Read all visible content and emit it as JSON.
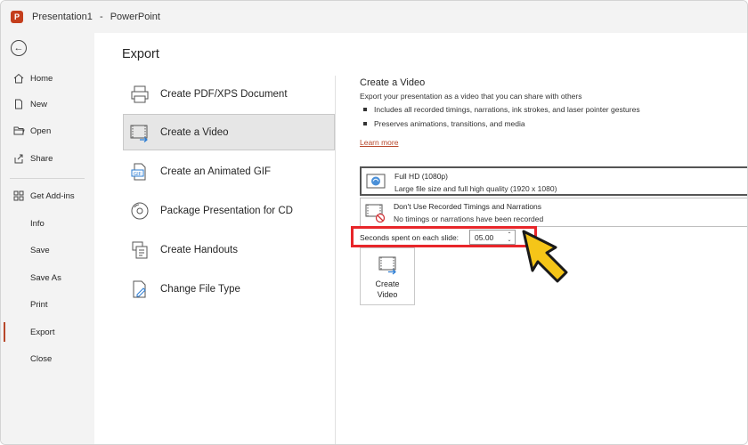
{
  "window": {
    "app_icon_letter": "P",
    "doc_name": "Presentation1",
    "separator": "-",
    "app_name": "PowerPoint"
  },
  "sidebar": {
    "back_icon": "back-arrow-icon",
    "items": [
      {
        "label": "Home",
        "icon": "home-icon"
      },
      {
        "label": "New",
        "icon": "new-file-icon"
      },
      {
        "label": "Open",
        "icon": "folder-open-icon"
      },
      {
        "label": "Share",
        "icon": "share-icon"
      },
      {
        "label": "Get Add-ins",
        "icon": "grid-icon"
      },
      {
        "label": "Info"
      },
      {
        "label": "Save"
      },
      {
        "label": "Save As"
      },
      {
        "label": "Print"
      },
      {
        "label": "Export",
        "active": true
      },
      {
        "label": "Close"
      }
    ]
  },
  "main": {
    "title": "Export",
    "options": [
      {
        "label": "Create PDF/XPS Document",
        "icon": "pdf-printer-icon"
      },
      {
        "label": "Create a Video",
        "icon": "video-icon",
        "selected": true
      },
      {
        "label": "Create an Animated GIF",
        "icon": "gif-icon"
      },
      {
        "label": "Package Presentation for CD",
        "icon": "cd-icon"
      },
      {
        "label": "Create Handouts",
        "icon": "handouts-icon"
      },
      {
        "label": "Change File Type",
        "icon": "file-type-icon"
      }
    ]
  },
  "detail": {
    "title": "Create a Video",
    "description": "Export your presentation as a video that you can share with others",
    "bullets": [
      "Includes all recorded timings, narrations, ink strokes, and laser pointer gestures",
      "Preserves animations, transitions, and media"
    ],
    "learn_more": "Learn more",
    "quality": {
      "title": "Full HD (1080p)",
      "subtitle": "Large file size and full high quality (1920 x 1080)"
    },
    "timings": {
      "title": "Don't Use Recorded Timings and Narrations",
      "subtitle": "No timings or narrations have been recorded"
    },
    "seconds_label": "Seconds spent on each slide:",
    "seconds_value": "05.00",
    "create_button_line1": "Create",
    "create_button_line2": "Video"
  },
  "colors": {
    "accent": "#b7472a",
    "highlight": "#e8262a",
    "pointer_fill": "#f5c518"
  }
}
